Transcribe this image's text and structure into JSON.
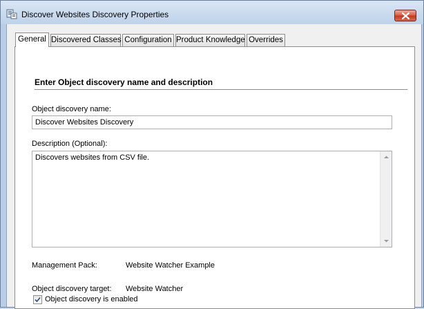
{
  "window": {
    "title": "Discover Websites Discovery Properties"
  },
  "tabs": [
    {
      "label": "General"
    },
    {
      "label": "Discovered Classes"
    },
    {
      "label": "Configuration"
    },
    {
      "label": "Product Knowledge"
    },
    {
      "label": "Overrides"
    }
  ],
  "general": {
    "section_header": "Enter Object discovery name and description",
    "name_label": "Object discovery name:",
    "name_value": "Discover Websites Discovery",
    "description_label": "Description (Optional):",
    "description_value": "Discovers websites from CSV file.",
    "management_pack_label": "Management Pack:",
    "management_pack_value": "Website Watcher Example",
    "target_label": "Object discovery target:",
    "target_value": "Website Watcher",
    "enabled_label": "Object discovery is enabled",
    "enabled_checked": true
  },
  "icons": {
    "app": "properties-window-icon",
    "close": "close-icon",
    "scroll_up": "chevron-up-icon",
    "scroll_down": "chevron-down-icon",
    "check": "checkmark-icon"
  }
}
